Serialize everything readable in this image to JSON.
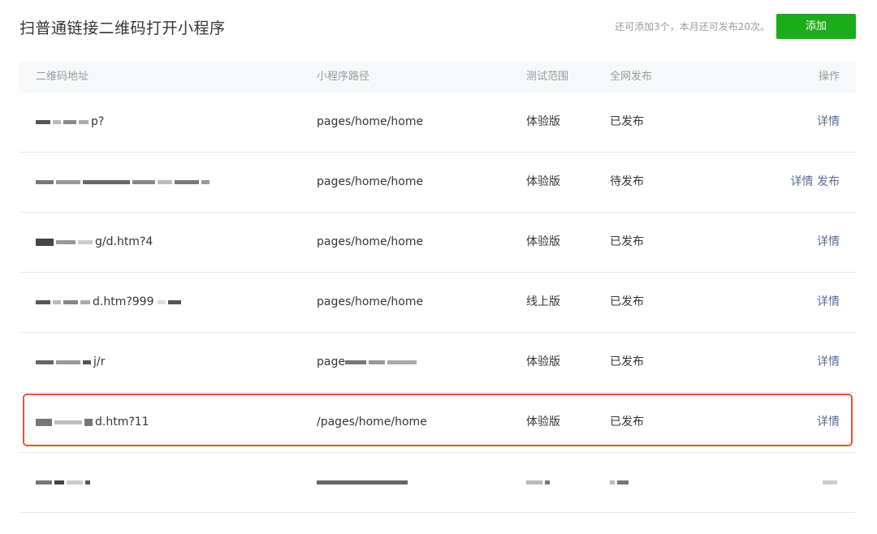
{
  "header": {
    "title": "扫普通链接二维码打开小程序",
    "quota_text": "还可添加3个，本月还可发布20次。",
    "add_button": "添加"
  },
  "table": {
    "columns": [
      "二维码地址",
      "小程序路径",
      "测试范围",
      "全网发布",
      "操作"
    ],
    "rows": [
      {
        "url_visible": "p?",
        "path": "pages/home/home",
        "scope": "体验版",
        "status": "已发布",
        "action1": "详情",
        "action2": ""
      },
      {
        "url_visible": "",
        "path": "pages/home/home",
        "scope": "体验版",
        "status": "待发布",
        "action1": "详情",
        "action2": "发布"
      },
      {
        "url_visible": "g/d.htm?4",
        "path": "pages/home/home",
        "scope": "体验版",
        "status": "已发布",
        "action1": "详情",
        "action2": ""
      },
      {
        "url_visible": "d.htm?999",
        "path": "pages/home/home",
        "scope": "线上版",
        "status": "已发布",
        "action1": "详情",
        "action2": ""
      },
      {
        "url_visible": "j/r",
        "path": "page",
        "scope": "体验版",
        "status": "已发布",
        "action1": "详情",
        "action2": ""
      },
      {
        "url_visible": "d.htm?11",
        "path": "/pages/home/home",
        "scope": "体验版",
        "status": "已发布",
        "action1": "详情",
        "action2": ""
      },
      {
        "url_visible": "",
        "path": "",
        "scope": "",
        "status": "",
        "action1": "",
        "action2": ""
      }
    ]
  },
  "colors": {
    "accent_green": "#1aad19",
    "link_blue": "#576b95",
    "highlight_border": "#e0553a"
  }
}
